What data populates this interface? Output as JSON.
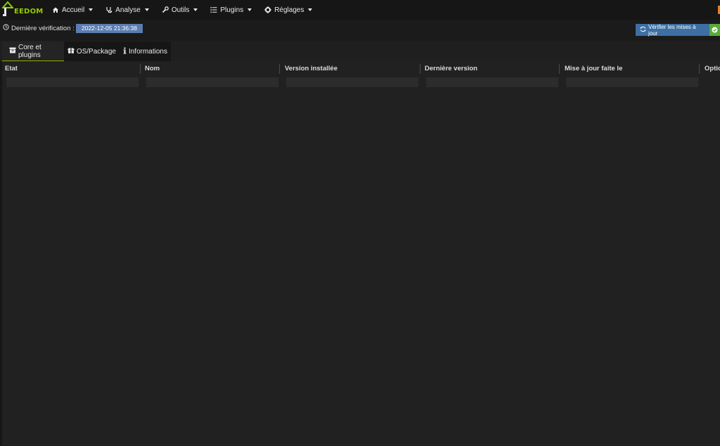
{
  "app": {
    "logo_text": "EEDOM",
    "brand_color": "#94ca02"
  },
  "nav": {
    "items": [
      {
        "label": "Accueil",
        "icon": "home-icon"
      },
      {
        "label": "Analyse",
        "icon": "stethoscope-icon"
      },
      {
        "label": "Outils",
        "icon": "wrench-icon"
      },
      {
        "label": "Plugins",
        "icon": "list-icon"
      },
      {
        "label": "Réglages",
        "icon": "gear-icon"
      }
    ]
  },
  "header": {
    "last_check_label": "Dernière vérification :",
    "last_check_value": "2022-12-05 21:36:38",
    "check_button_label": "Vérifier les mises à jour"
  },
  "tabs": [
    {
      "label": "Core et plugins",
      "icon": "archive-icon",
      "active": true
    },
    {
      "label": "OS/Package",
      "icon": "gift-icon",
      "active": false
    },
    {
      "label": "Informations",
      "icon": "info-icon",
      "active": false
    }
  ],
  "table": {
    "columns": [
      "Etat",
      "Nom",
      "Version installée",
      "Dernière version",
      "Mise à jour faite le",
      "Options"
    ],
    "rows": []
  },
  "colors": {
    "badge": "#5b7db1",
    "button": "#3d6fa3",
    "success": "#5bac36",
    "tab_active_border": "#8fb000"
  }
}
